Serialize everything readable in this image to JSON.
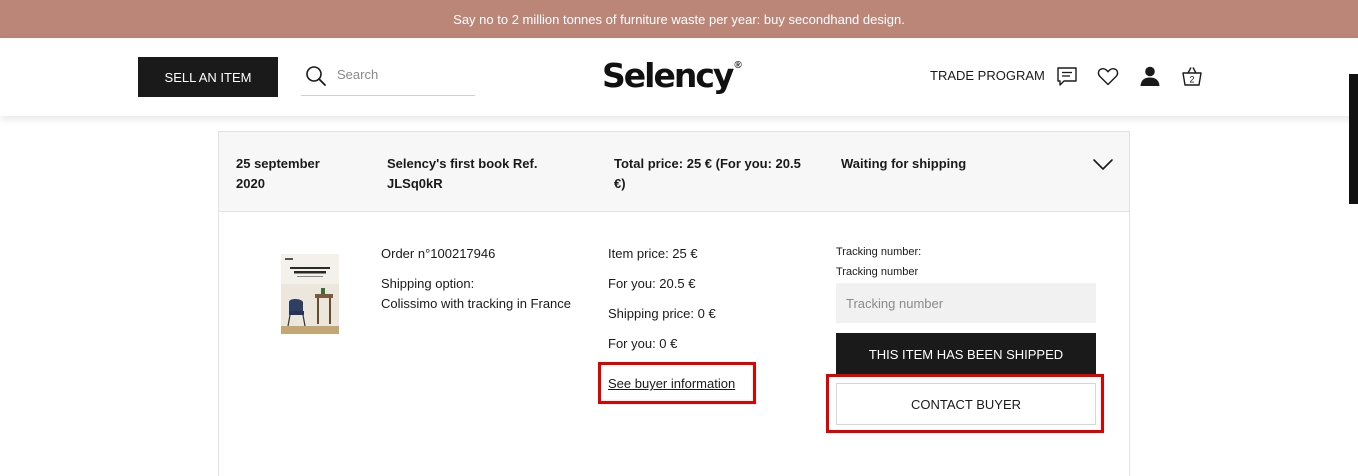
{
  "banner": {
    "text": "Say no to 2 million tonnes of furniture waste per year: buy secondhand design."
  },
  "header": {
    "sell_button": "SELL AN ITEM",
    "search_placeholder": "Search",
    "logo": "Selency",
    "logo_mark": "®",
    "trade_program": "TRADE PROGRAM",
    "cart_count": "2",
    "icons": [
      "search-icon",
      "messages-icon",
      "heart-icon",
      "user-icon",
      "basket-icon"
    ]
  },
  "order": {
    "date": "25 september 2020",
    "title": "Selency's first book Ref. JLSq0kR",
    "total": "Total price: 25 € (For you: 20.5 €)",
    "status": "Waiting for shipping",
    "order_number": "Order n°100217946",
    "shipping_option_label": "Shipping option:",
    "shipping_option": "Colissimo with tracking in France",
    "item_price": "Item price: 25 €",
    "for_you": "For you: 20.5 €",
    "shipping_price": "Shipping price: 0 €",
    "for_you_shipping": "For you: 0 €",
    "buyer_info_link": "See buyer information",
    "tracking_label": "Tracking number:",
    "tracking_sublabel": "Tracking number",
    "tracking_placeholder": "Tracking number",
    "shipped_button": "THIS ITEM HAS BEEN SHIPPED",
    "contact_button": "CONTACT BUYER"
  },
  "colors": {
    "banner": "#bb8677",
    "dark_button": "#1a1a1a",
    "highlight": "#e00000"
  }
}
